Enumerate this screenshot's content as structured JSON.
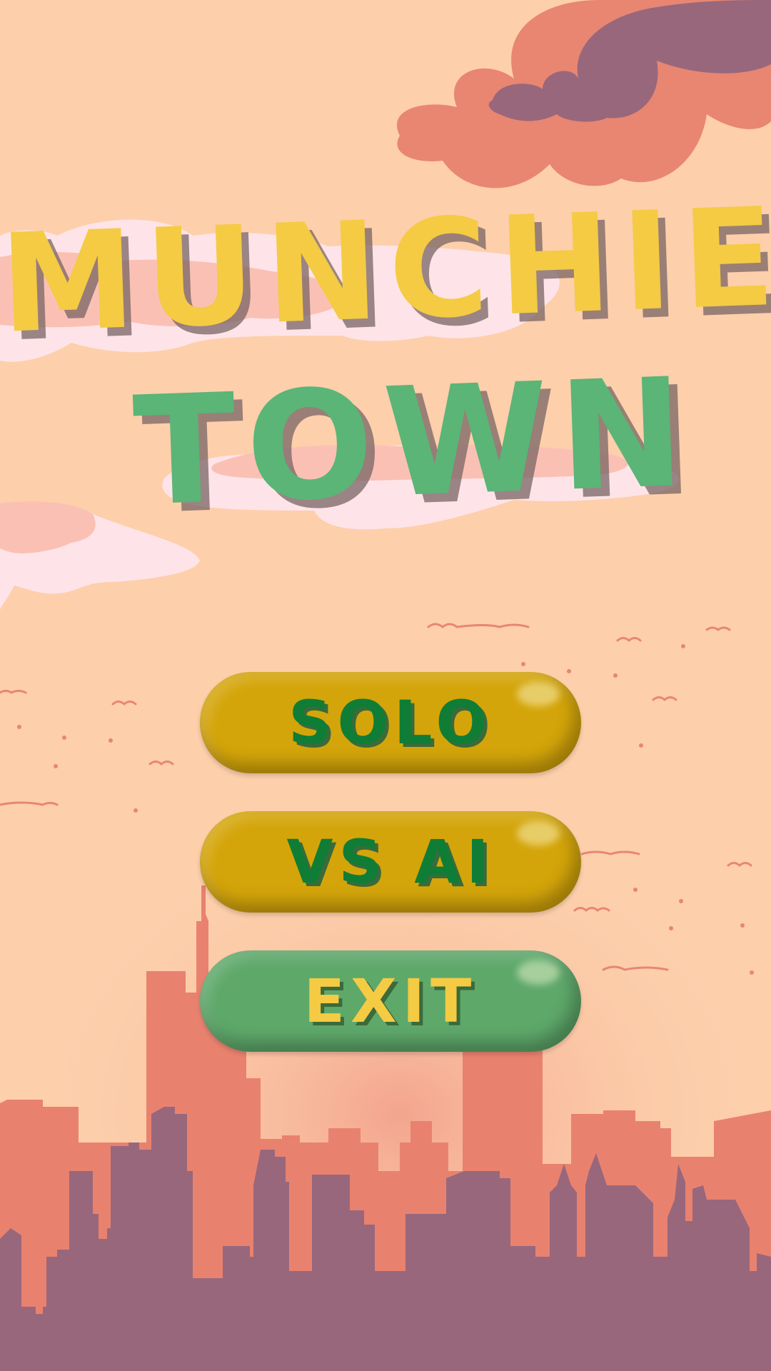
{
  "title": {
    "line1": "MUNCHIE",
    "line2": "TOWN",
    "line1_color": "#f4cb43",
    "line2_color": "#5ab577"
  },
  "menu": {
    "buttons": [
      {
        "label": "SOLO",
        "bg": "#d4a50a",
        "text_color": "#0f7d36"
      },
      {
        "label": "VS AI",
        "bg": "#d4a50a",
        "text_color": "#0f7d36"
      },
      {
        "label": "EXIT",
        "bg": "#5ea86a",
        "text_color": "#f4cb43"
      }
    ]
  },
  "colors": {
    "sky": "#fdcfab",
    "cloud_coral": "#e88672",
    "cloud_purple": "#98677c",
    "cloud_pink": "#fbc0b4",
    "cloud_white": "#fee4e8",
    "building_back": "#e8826f",
    "building_front": "#98677c",
    "birds": "#e88672"
  }
}
